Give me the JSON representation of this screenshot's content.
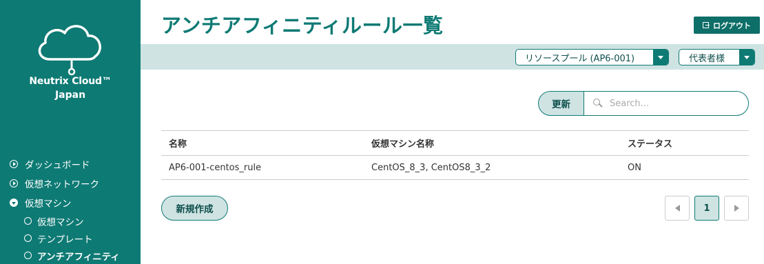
{
  "brand": {
    "name_line1": "Neutrix Cloud™",
    "name_line2": "Japan"
  },
  "sidebar": {
    "items": [
      {
        "label": "ダッシュボード",
        "icon": "chevron-right-circle-icon"
      },
      {
        "label": "仮想ネットワーク",
        "icon": "chevron-right-circle-icon"
      },
      {
        "label": "仮想マシン",
        "icon": "chevron-down-circle-icon"
      }
    ],
    "subitems": [
      {
        "label": "仮想マシン"
      },
      {
        "label": "テンプレート"
      },
      {
        "label": "アンチアフィニティ"
      }
    ]
  },
  "header": {
    "title": "アンチアフィニティルール一覧",
    "logout_label": "ログアウト",
    "resource_pool": "リソースプール (AP6-001)",
    "role": "代表者様"
  },
  "toolbar": {
    "refresh_label": "更新",
    "search_placeholder": "Search..."
  },
  "table": {
    "headers": [
      "名称",
      "仮想マシン名称",
      "ステータス"
    ],
    "rows": [
      [
        "AP6-001-centos_rule",
        "CentOS_8_3, CentOS8_3_2",
        "ON"
      ]
    ]
  },
  "actions": {
    "create_label": "新規作成"
  },
  "pagination": {
    "current": "1"
  },
  "colors": {
    "primary": "#0e7a74",
    "band": "#cfe3e3"
  }
}
